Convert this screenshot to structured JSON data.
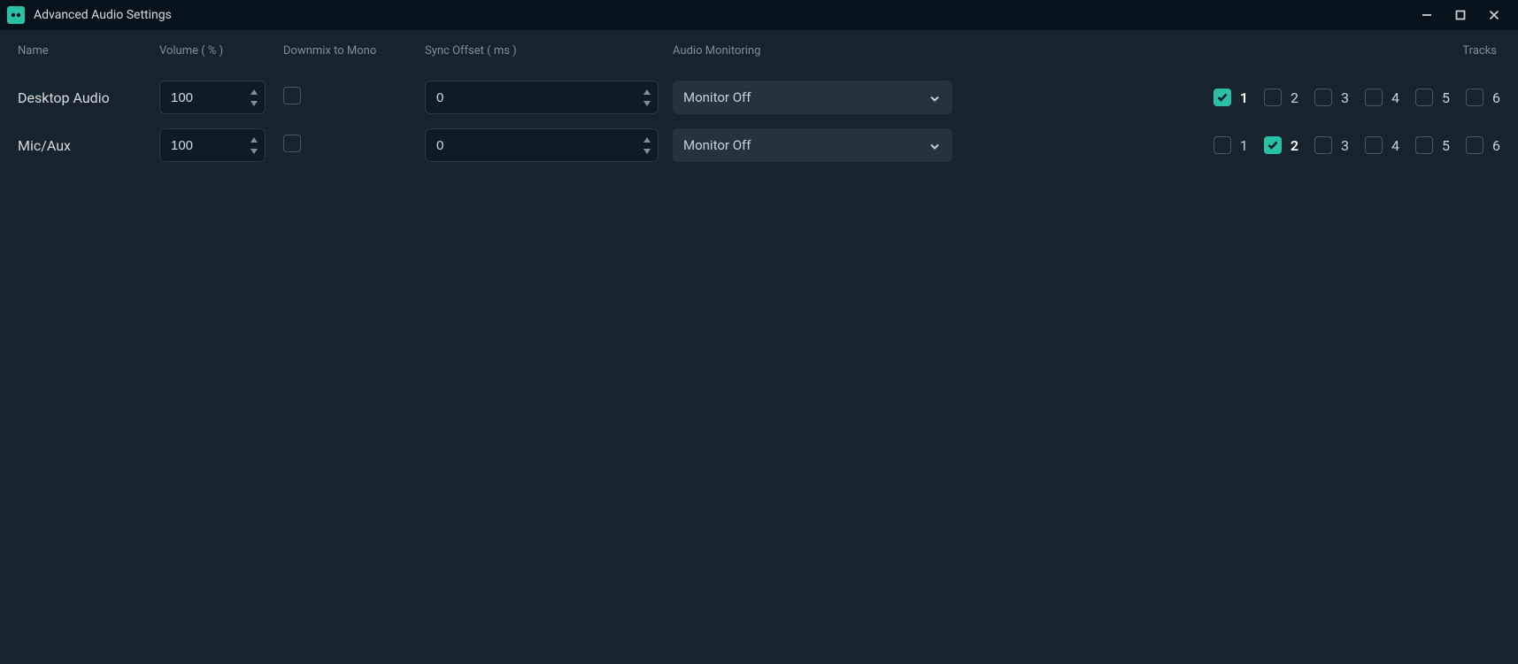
{
  "window": {
    "title": "Advanced Audio Settings"
  },
  "columns": {
    "name": "Name",
    "volume": "Volume ( % )",
    "downmix": "Downmix to Mono",
    "sync": "Sync Offset ( ms )",
    "monitoring": "Audio Monitoring",
    "tracks": "Tracks"
  },
  "rows": [
    {
      "name": "Desktop Audio",
      "volume": "100",
      "downmix": false,
      "sync": "0",
      "monitoring": "Monitor Off",
      "tracks": [
        true,
        false,
        false,
        false,
        false,
        false
      ]
    },
    {
      "name": "Mic/Aux",
      "volume": "100",
      "downmix": false,
      "sync": "0",
      "monitoring": "Monitor Off",
      "tracks": [
        false,
        true,
        false,
        false,
        false,
        false
      ]
    }
  ],
  "track_labels": [
    "1",
    "2",
    "3",
    "4",
    "5",
    "6"
  ]
}
